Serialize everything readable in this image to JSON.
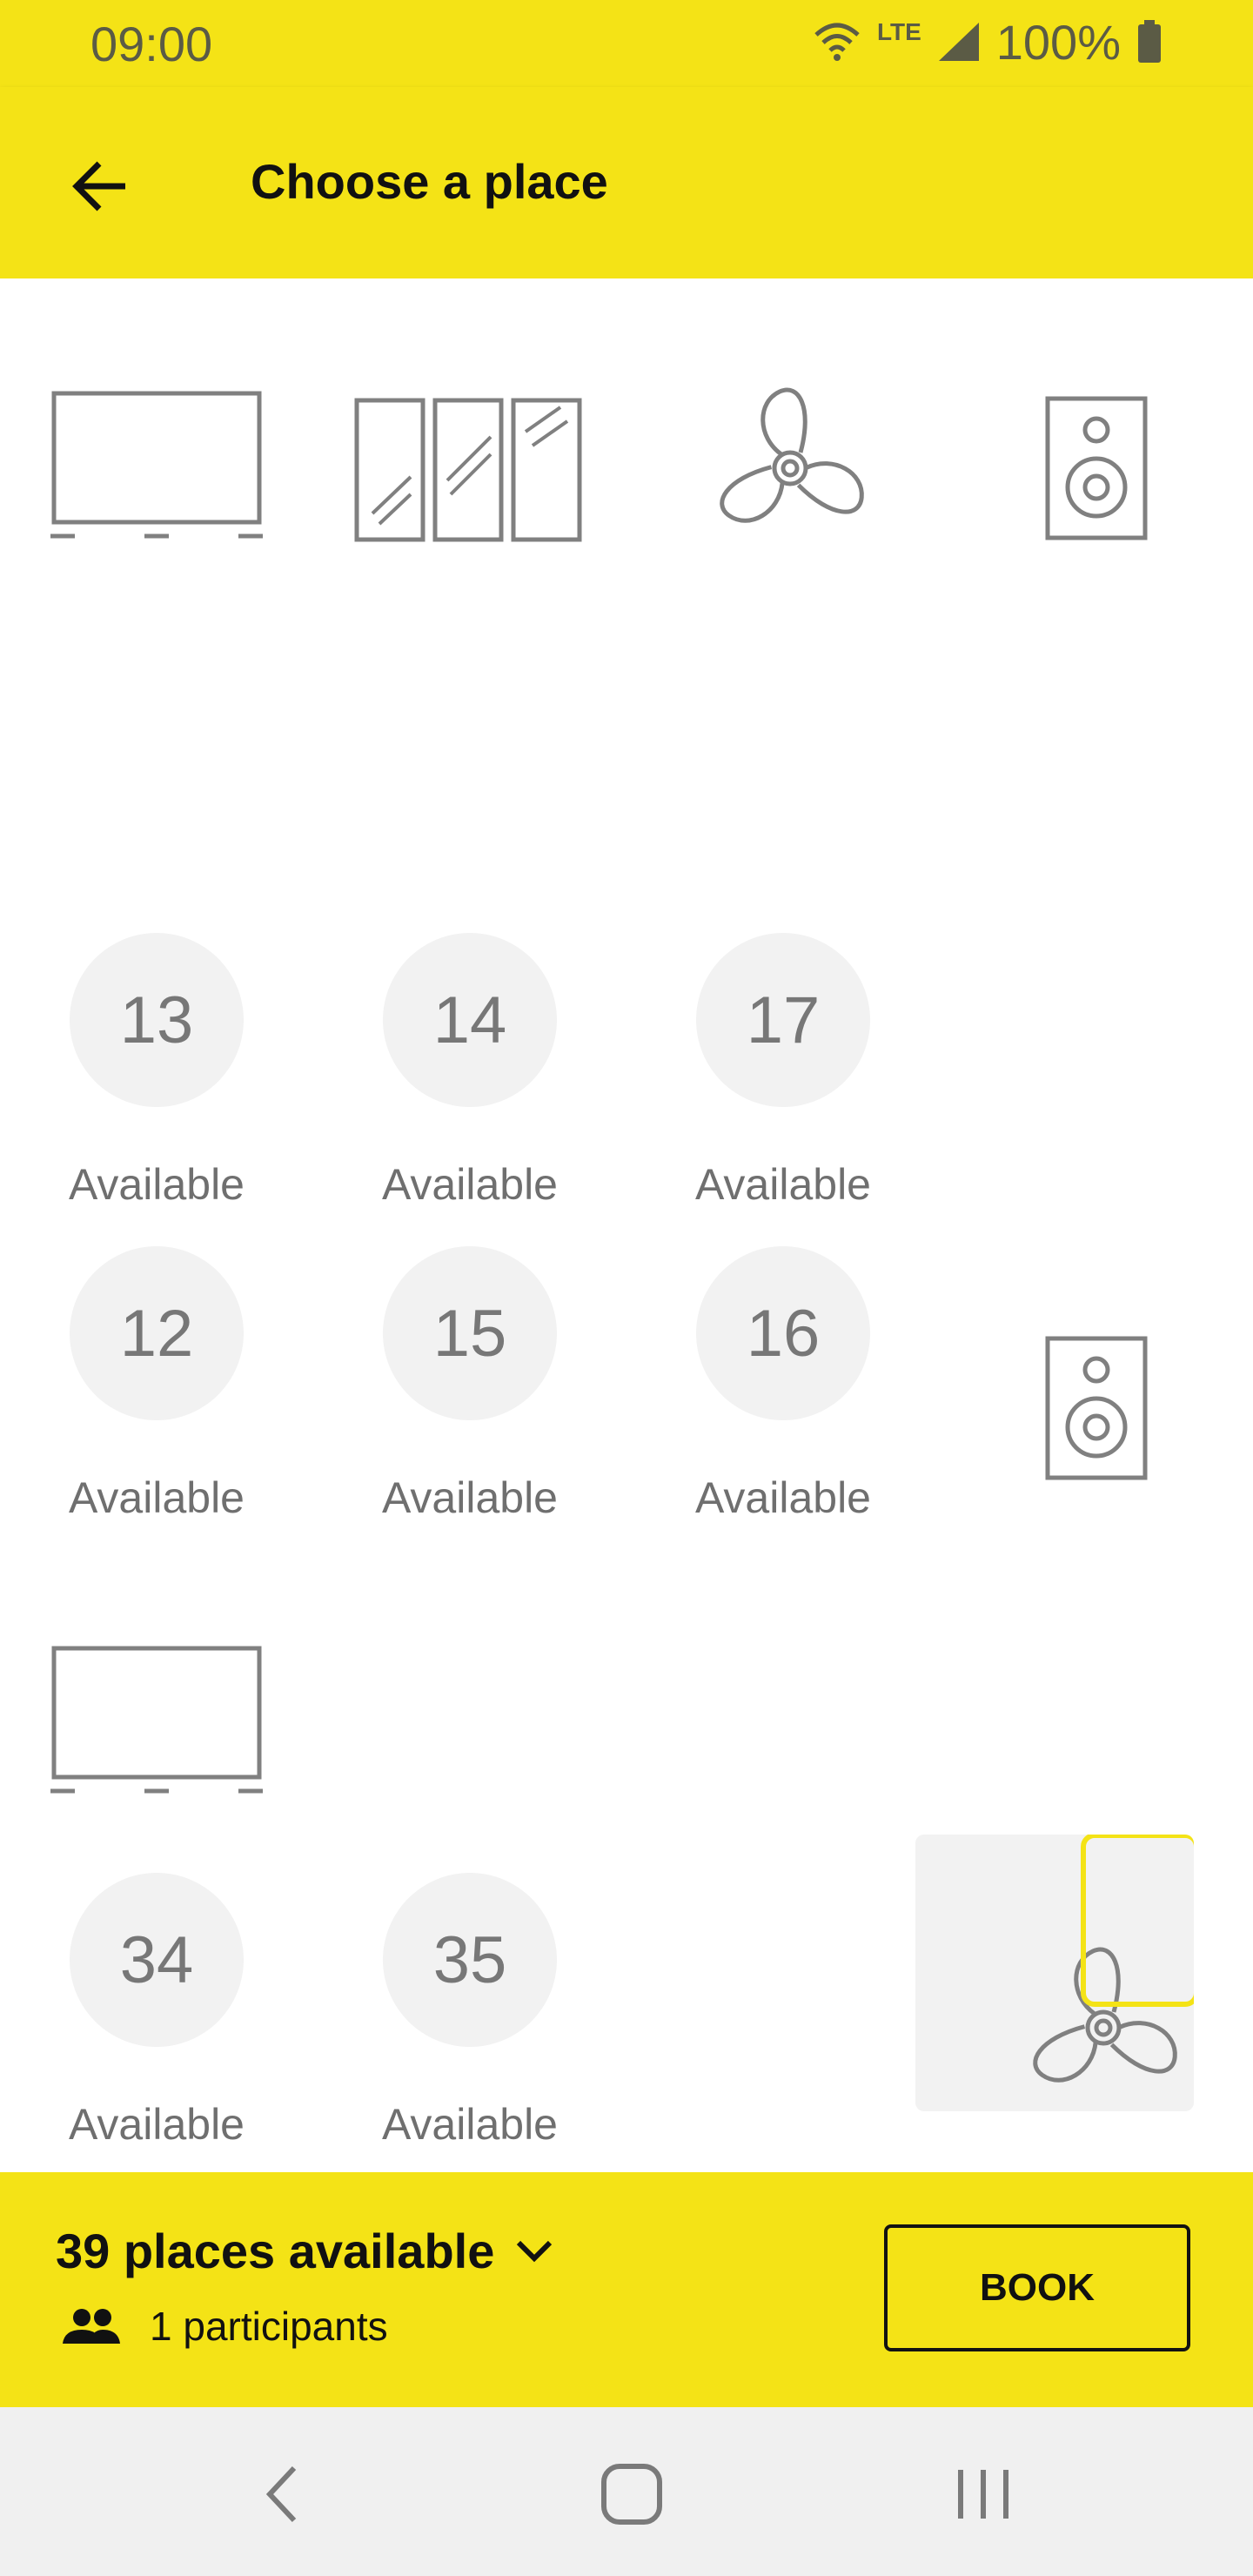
{
  "status_bar": {
    "time": "09:00",
    "network": "LTE",
    "battery": "100%",
    "icons": [
      "wifi-icon",
      "signal-icon",
      "battery-icon"
    ]
  },
  "app_bar": {
    "title": "Choose a place",
    "back_icon": "arrow-back-icon"
  },
  "map": {
    "objects": [
      "tv-icon",
      "window-icon",
      "fan-icon",
      "speaker-icon",
      "speaker-icon",
      "tv-icon",
      "fan-icon"
    ],
    "seats": [
      {
        "number": "13",
        "status": "Available"
      },
      {
        "number": "14",
        "status": "Available"
      },
      {
        "number": "17",
        "status": "Available"
      },
      {
        "number": "12",
        "status": "Available"
      },
      {
        "number": "15",
        "status": "Available"
      },
      {
        "number": "16",
        "status": "Available"
      },
      {
        "number": "34",
        "status": "Available"
      },
      {
        "number": "35",
        "status": "Available"
      }
    ]
  },
  "bottom": {
    "places_label": "39 places available",
    "participants_label": "1 participants",
    "book_label": "BOOK"
  },
  "colors": {
    "accent": "#f4e316",
    "seat_bg": "#f2f2f2",
    "seat_text": "#777777",
    "icon_stroke": "#808080"
  }
}
